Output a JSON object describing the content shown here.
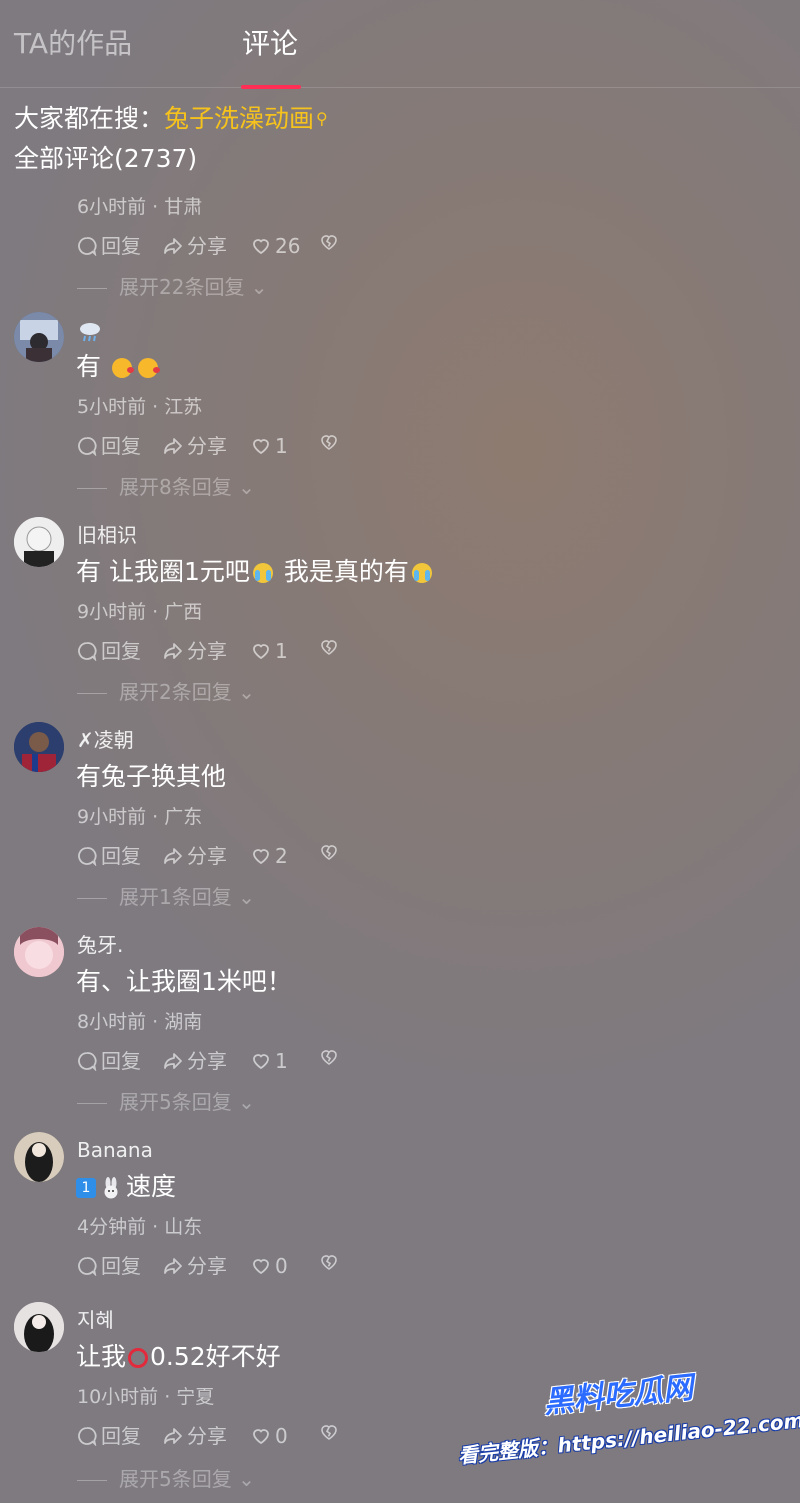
{
  "tabs": {
    "works": "TA的作品",
    "comments": "评论"
  },
  "search": {
    "prefix": "大家都在搜：",
    "trend": "兔子洗澡动画",
    "icon": "search-icon"
  },
  "comment_count": "全部评论(2737)",
  "actions": {
    "reply": "回复",
    "share": "分享"
  },
  "comments": [
    {
      "username": "",
      "text": "",
      "meta": "6小时前 · 甘肃",
      "likes": "26",
      "expand": "展开22条回复"
    },
    {
      "username": "",
      "username_icon": "rain-cloud-emoji",
      "text": "有",
      "text_emojis": [
        "kiss-emoji",
        "kiss-emoji"
      ],
      "meta": "5小时前 · 江苏",
      "likes": "1",
      "expand": "展开8条回复",
      "avatar_color": "#5a6a88"
    },
    {
      "username": "旧相识",
      "text_a": "有 让我圈1元吧",
      "text_b": "我是真的有",
      "text_emojis": [
        "crying-emoji",
        "crying-emoji"
      ],
      "meta": "9小时前 · 广西",
      "likes": "1",
      "expand": "展开2条回复",
      "avatar_color": "#d9d9d9"
    },
    {
      "username": "✗凌朝",
      "text": "有兔子换其他",
      "meta": "9小时前 · 广东",
      "likes": "2",
      "expand": "展开1条回复",
      "avatar_color": "#2a3a66"
    },
    {
      "username": "兔牙.",
      "text": "有、让我圈1米吧！",
      "meta": "8小时前 · 湖南",
      "likes": "1",
      "expand": "展开5条回复",
      "avatar_color": "#e8b8c4"
    },
    {
      "username": "Banana",
      "text": "速度",
      "text_icons": [
        "number-one-badge",
        "rabbit-emoji"
      ],
      "badge_text": "1",
      "meta": "4分钟前 · 山东",
      "likes": "0",
      "expand": "",
      "avatar_color": "#3a3430"
    },
    {
      "username": "지혜",
      "text_a": "让我",
      "text_b": "0.52好不好",
      "text_icons": [
        "red-circle-emoji"
      ],
      "meta": "10小时前 · 宁夏",
      "likes": "0",
      "expand": "展开5条回复",
      "avatar_color": "#d8d4d4"
    }
  ],
  "watermark": {
    "brand": "黑料吃瓜网",
    "url": "看完整版：https://heiliao-22.com"
  },
  "colors": {
    "accent": "#ff2e55",
    "trend": "#f6c21c"
  }
}
